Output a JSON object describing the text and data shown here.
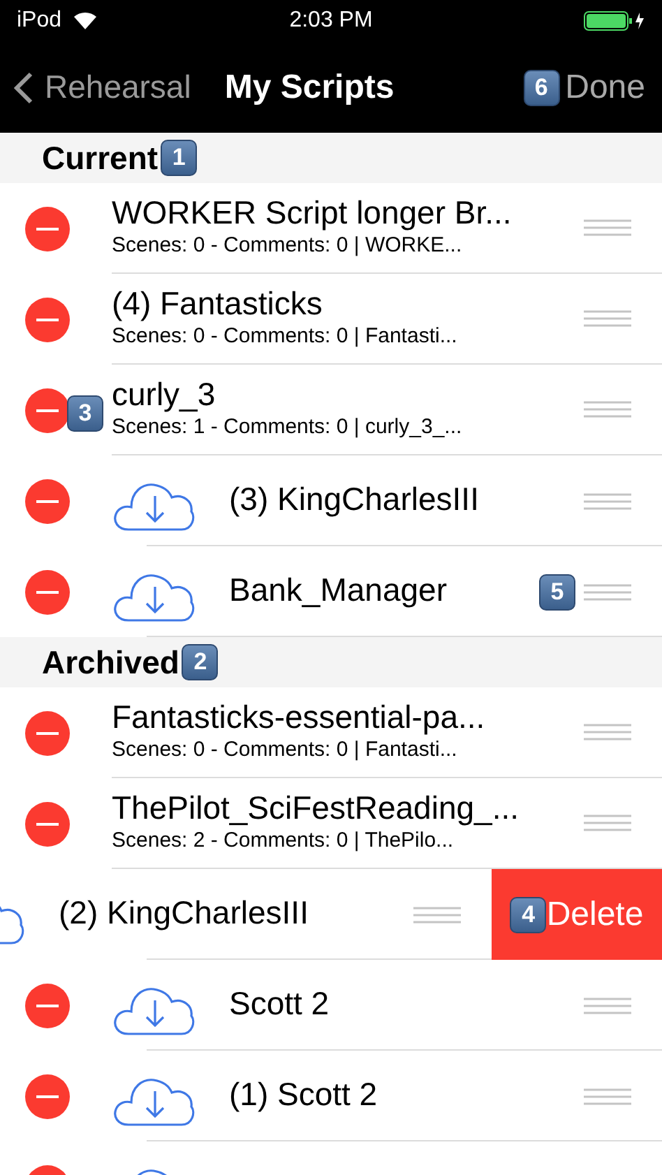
{
  "status_bar": {
    "carrier": "iPod",
    "time": "2:03 PM"
  },
  "nav": {
    "back": "Rehearsal",
    "title": "My Scripts",
    "done_badge": "6",
    "done": "Done"
  },
  "sections": [
    {
      "title": "Current",
      "badge": "1",
      "rows": [
        {
          "kind": "detail",
          "title": "WORKER Script longer Br...",
          "subtitle": "Scenes: 0 - Comments: 0 | WORKE...",
          "swiped": false
        },
        {
          "kind": "detail",
          "title": "(4) Fantasticks",
          "subtitle": "Scenes: 0 - Comments: 0 | Fantasti...",
          "swiped": false
        },
        {
          "kind": "detail",
          "title": "curly_3",
          "subtitle": "Scenes: 1 - Comments: 0 | curly_3_...",
          "swiped": false,
          "delete_badge": "3"
        },
        {
          "kind": "cloud",
          "title": "(3) KingCharlesIII",
          "swiped": false
        },
        {
          "kind": "cloud",
          "title": "Bank_Manager",
          "swiped": false,
          "reorder_badge": "5"
        }
      ]
    },
    {
      "title": "Archived",
      "badge": "2",
      "rows": [
        {
          "kind": "detail",
          "title": "Fantasticks-essential-pa...",
          "subtitle": "Scenes: 0 - Comments: 0 | Fantasti...",
          "swiped": false
        },
        {
          "kind": "detail",
          "title": "ThePilot_SciFestReading_...",
          "subtitle": "Scenes: 2 - Comments: 0 | ThePilo...",
          "swiped": false
        },
        {
          "kind": "cloud",
          "title": "(2) KingCharlesIII",
          "swiped": true,
          "action": "Delete",
          "action_badge": "4"
        },
        {
          "kind": "cloud",
          "title": "Scott 2",
          "swiped": false
        },
        {
          "kind": "cloud",
          "title": "(1) Scott 2",
          "swiped": false
        },
        {
          "kind": "cloud",
          "swiped": false
        }
      ]
    }
  ]
}
